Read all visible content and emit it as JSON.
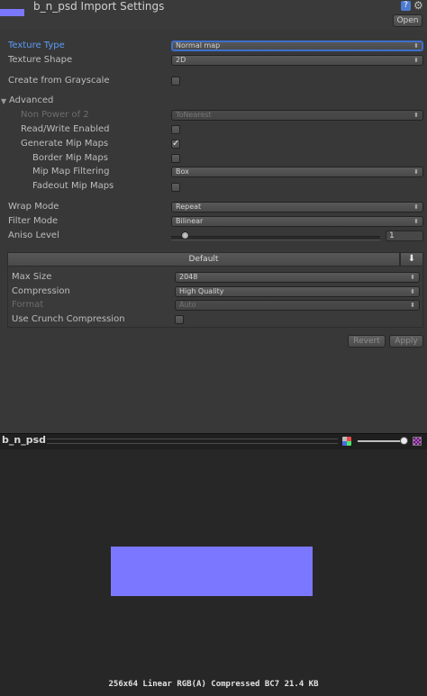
{
  "header": {
    "title": "b_n_psd Import Settings",
    "open_label": "Open",
    "help_glyph": "?",
    "gear_glyph": "⚙"
  },
  "texture_type": {
    "label": "Texture Type",
    "value": "Normal map"
  },
  "texture_shape": {
    "label": "Texture Shape",
    "value": "2D"
  },
  "create_from_grayscale": {
    "label": "Create from Grayscale",
    "checked": false
  },
  "advanced": {
    "label": "Advanced",
    "expanded": true,
    "non_power_of_2": {
      "label": "Non Power of 2",
      "value": "ToNearest",
      "disabled": true
    },
    "read_write": {
      "label": "Read/Write Enabled",
      "checked": false
    },
    "generate_mips": {
      "label": "Generate Mip Maps",
      "checked": true
    },
    "border_mips": {
      "label": "Border Mip Maps",
      "checked": false
    },
    "mip_filtering": {
      "label": "Mip Map Filtering",
      "value": "Box"
    },
    "fadeout_mips": {
      "label": "Fadeout Mip Maps",
      "checked": false
    }
  },
  "wrap_mode": {
    "label": "Wrap Mode",
    "value": "Repeat"
  },
  "filter_mode": {
    "label": "Filter Mode",
    "value": "Bilinear"
  },
  "aniso_level": {
    "label": "Aniso Level",
    "value": "1"
  },
  "platform": {
    "tab_label": "Default",
    "max_size": {
      "label": "Max Size",
      "value": "2048"
    },
    "compression": {
      "label": "Compression",
      "value": "High Quality"
    },
    "format": {
      "label": "Format",
      "value": "Auto",
      "disabled": true
    },
    "crunch": {
      "label": "Use Crunch Compression",
      "checked": false
    }
  },
  "actions": {
    "revert_label": "Revert",
    "apply_label": "Apply"
  },
  "preview": {
    "name": "b_n_psd",
    "info": "256x64 Linear  RGB(A) Compressed BC7   21.4 KB",
    "texture_color": "#7b78ff"
  },
  "colors": {
    "accent": "#5a9cf6",
    "texture": "#7b78ff",
    "background": "#383838"
  }
}
